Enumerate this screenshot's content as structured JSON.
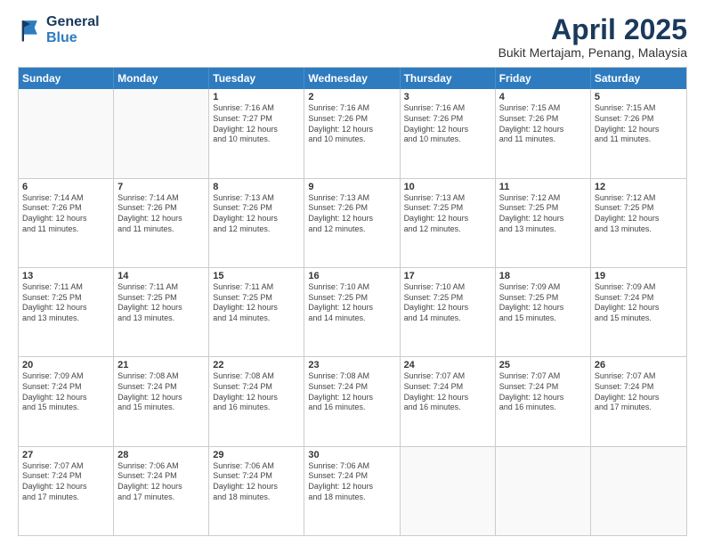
{
  "header": {
    "logo_line1": "General",
    "logo_line2": "Blue",
    "title": "April 2025",
    "subtitle": "Bukit Mertajam, Penang, Malaysia"
  },
  "weekdays": [
    "Sunday",
    "Monday",
    "Tuesday",
    "Wednesday",
    "Thursday",
    "Friday",
    "Saturday"
  ],
  "weeks": [
    [
      {
        "day": "",
        "info": ""
      },
      {
        "day": "",
        "info": ""
      },
      {
        "day": "1",
        "info": "Sunrise: 7:16 AM\nSunset: 7:27 PM\nDaylight: 12 hours\nand 10 minutes."
      },
      {
        "day": "2",
        "info": "Sunrise: 7:16 AM\nSunset: 7:26 PM\nDaylight: 12 hours\nand 10 minutes."
      },
      {
        "day": "3",
        "info": "Sunrise: 7:16 AM\nSunset: 7:26 PM\nDaylight: 12 hours\nand 10 minutes."
      },
      {
        "day": "4",
        "info": "Sunrise: 7:15 AM\nSunset: 7:26 PM\nDaylight: 12 hours\nand 11 minutes."
      },
      {
        "day": "5",
        "info": "Sunrise: 7:15 AM\nSunset: 7:26 PM\nDaylight: 12 hours\nand 11 minutes."
      }
    ],
    [
      {
        "day": "6",
        "info": "Sunrise: 7:14 AM\nSunset: 7:26 PM\nDaylight: 12 hours\nand 11 minutes."
      },
      {
        "day": "7",
        "info": "Sunrise: 7:14 AM\nSunset: 7:26 PM\nDaylight: 12 hours\nand 11 minutes."
      },
      {
        "day": "8",
        "info": "Sunrise: 7:13 AM\nSunset: 7:26 PM\nDaylight: 12 hours\nand 12 minutes."
      },
      {
        "day": "9",
        "info": "Sunrise: 7:13 AM\nSunset: 7:26 PM\nDaylight: 12 hours\nand 12 minutes."
      },
      {
        "day": "10",
        "info": "Sunrise: 7:13 AM\nSunset: 7:25 PM\nDaylight: 12 hours\nand 12 minutes."
      },
      {
        "day": "11",
        "info": "Sunrise: 7:12 AM\nSunset: 7:25 PM\nDaylight: 12 hours\nand 13 minutes."
      },
      {
        "day": "12",
        "info": "Sunrise: 7:12 AM\nSunset: 7:25 PM\nDaylight: 12 hours\nand 13 minutes."
      }
    ],
    [
      {
        "day": "13",
        "info": "Sunrise: 7:11 AM\nSunset: 7:25 PM\nDaylight: 12 hours\nand 13 minutes."
      },
      {
        "day": "14",
        "info": "Sunrise: 7:11 AM\nSunset: 7:25 PM\nDaylight: 12 hours\nand 13 minutes."
      },
      {
        "day": "15",
        "info": "Sunrise: 7:11 AM\nSunset: 7:25 PM\nDaylight: 12 hours\nand 14 minutes."
      },
      {
        "day": "16",
        "info": "Sunrise: 7:10 AM\nSunset: 7:25 PM\nDaylight: 12 hours\nand 14 minutes."
      },
      {
        "day": "17",
        "info": "Sunrise: 7:10 AM\nSunset: 7:25 PM\nDaylight: 12 hours\nand 14 minutes."
      },
      {
        "day": "18",
        "info": "Sunrise: 7:09 AM\nSunset: 7:25 PM\nDaylight: 12 hours\nand 15 minutes."
      },
      {
        "day": "19",
        "info": "Sunrise: 7:09 AM\nSunset: 7:24 PM\nDaylight: 12 hours\nand 15 minutes."
      }
    ],
    [
      {
        "day": "20",
        "info": "Sunrise: 7:09 AM\nSunset: 7:24 PM\nDaylight: 12 hours\nand 15 minutes."
      },
      {
        "day": "21",
        "info": "Sunrise: 7:08 AM\nSunset: 7:24 PM\nDaylight: 12 hours\nand 15 minutes."
      },
      {
        "day": "22",
        "info": "Sunrise: 7:08 AM\nSunset: 7:24 PM\nDaylight: 12 hours\nand 16 minutes."
      },
      {
        "day": "23",
        "info": "Sunrise: 7:08 AM\nSunset: 7:24 PM\nDaylight: 12 hours\nand 16 minutes."
      },
      {
        "day": "24",
        "info": "Sunrise: 7:07 AM\nSunset: 7:24 PM\nDaylight: 12 hours\nand 16 minutes."
      },
      {
        "day": "25",
        "info": "Sunrise: 7:07 AM\nSunset: 7:24 PM\nDaylight: 12 hours\nand 16 minutes."
      },
      {
        "day": "26",
        "info": "Sunrise: 7:07 AM\nSunset: 7:24 PM\nDaylight: 12 hours\nand 17 minutes."
      }
    ],
    [
      {
        "day": "27",
        "info": "Sunrise: 7:07 AM\nSunset: 7:24 PM\nDaylight: 12 hours\nand 17 minutes."
      },
      {
        "day": "28",
        "info": "Sunrise: 7:06 AM\nSunset: 7:24 PM\nDaylight: 12 hours\nand 17 minutes."
      },
      {
        "day": "29",
        "info": "Sunrise: 7:06 AM\nSunset: 7:24 PM\nDaylight: 12 hours\nand 18 minutes."
      },
      {
        "day": "30",
        "info": "Sunrise: 7:06 AM\nSunset: 7:24 PM\nDaylight: 12 hours\nand 18 minutes."
      },
      {
        "day": "",
        "info": ""
      },
      {
        "day": "",
        "info": ""
      },
      {
        "day": "",
        "info": ""
      }
    ]
  ]
}
